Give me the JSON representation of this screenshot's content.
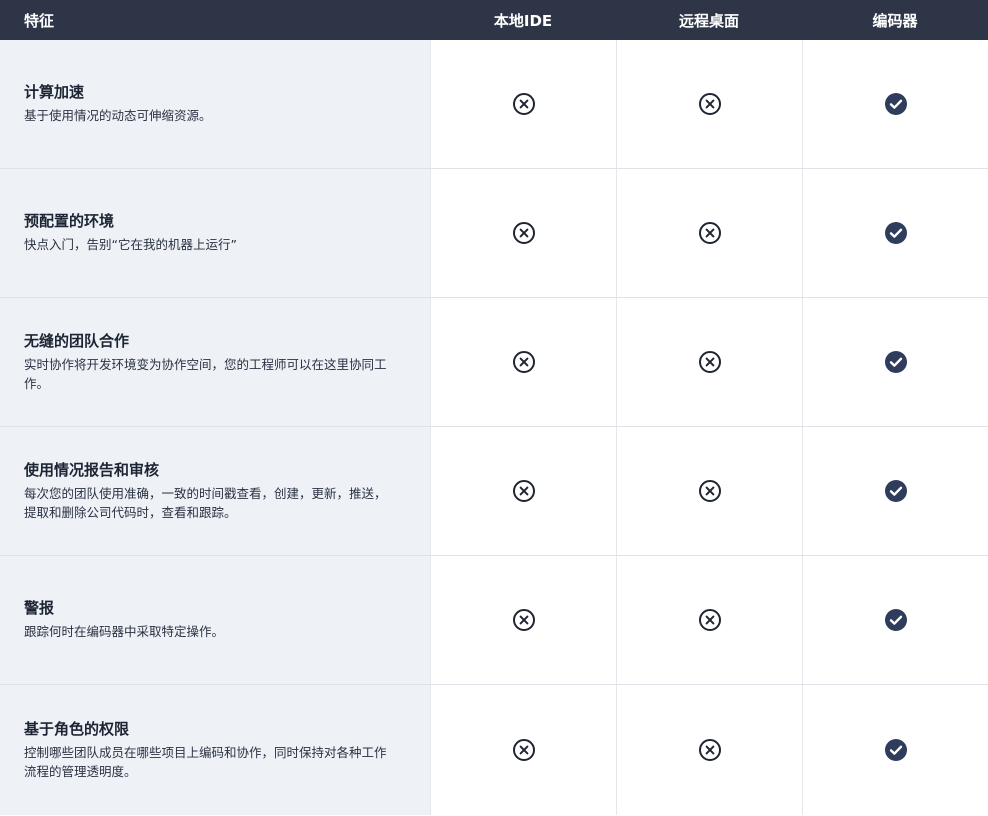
{
  "header": {
    "feature_label": "特征",
    "columns": [
      "本地IDE",
      "远程桌面",
      "编码器"
    ]
  },
  "rows": [
    {
      "title": "计算加速",
      "desc": "基于使用情况的动态可伸缩资源。",
      "values": [
        "x-circle-icon",
        "x-circle-icon",
        "check-circle-icon"
      ]
    },
    {
      "title": "预配置的环境",
      "desc": "快点入门，告别“它在我的机器上运行”",
      "values": [
        "x-circle-icon",
        "x-circle-icon",
        "check-circle-icon"
      ]
    },
    {
      "title": "无缝的团队合作",
      "desc": "实时协作将开发环境变为协作空间，您的工程师可以在这里协同工作。",
      "values": [
        "x-circle-icon",
        "x-circle-icon",
        "check-circle-icon"
      ]
    },
    {
      "title": "使用情况报告和审核",
      "desc": "每次您的团队使用准确，一致的时间戳查看，创建，更新，推送，提取和删除公司代码时，查看和跟踪。",
      "values": [
        "x-circle-icon",
        "x-circle-icon",
        "check-circle-icon"
      ]
    },
    {
      "title": "警报",
      "desc": "跟踪何时在编码器中采取特定操作。",
      "values": [
        "x-circle-icon",
        "x-circle-icon",
        "check-circle-icon"
      ]
    },
    {
      "title": "基于角色的权限",
      "desc": "控制哪些团队成员在哪些项目上编码和协作，同时保持对各种工作流程的管理透明度。",
      "values": [
        "x-circle-icon",
        "x-circle-icon",
        "check-circle-icon"
      ]
    }
  ],
  "colors": {
    "header_bg": "#2d3547",
    "feature_bg": "#eef2f6",
    "check_fill": "#2f3c5c",
    "x_stroke": "#1f2533"
  }
}
